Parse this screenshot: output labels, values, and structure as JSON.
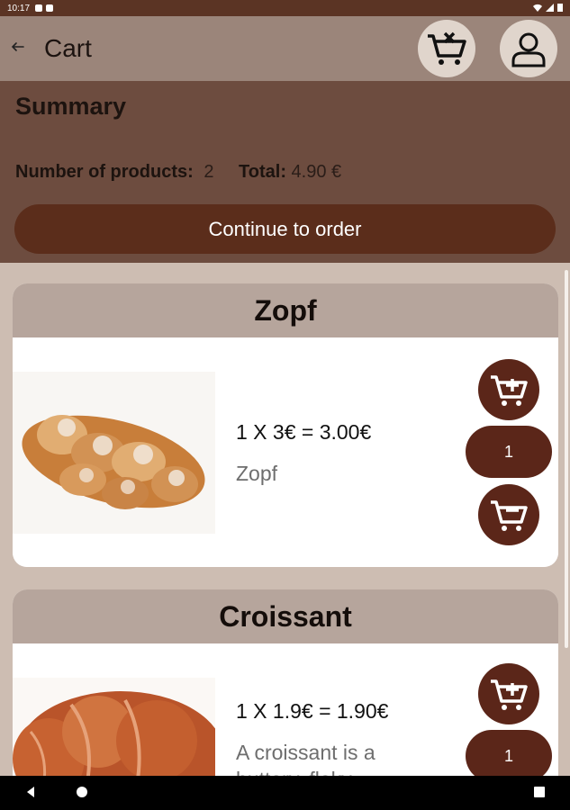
{
  "status": {
    "time": "10:17"
  },
  "appbar": {
    "title": "Cart"
  },
  "summary": {
    "heading": "Summary",
    "products_label": "Number of products:",
    "products_value": "2",
    "total_label": "Total:",
    "total_value": "4.90 €",
    "order_button": "Continue to order"
  },
  "products": [
    {
      "name": "Zopf",
      "price_line": "1 X 3€ = 3.00€",
      "description": "Zopf",
      "quantity": "1"
    },
    {
      "name": "Croissant",
      "price_line": "1 X 1.9€ = 1.90€",
      "description": "A croissant is a buttery, flaky",
      "quantity": "1"
    }
  ],
  "icons": {
    "back": "arrow-left-icon",
    "clear_cart": "cart-remove-icon",
    "profile": "person-icon",
    "add": "cart-plus-icon",
    "remove": "cart-minus-icon"
  },
  "colors": {
    "appbar": "#9b857a",
    "summary_bg": "#6d4c3f",
    "primary_button": "#5b2d1b",
    "card_header": "#b6a59c",
    "page_bg": "#cdbdb2"
  }
}
